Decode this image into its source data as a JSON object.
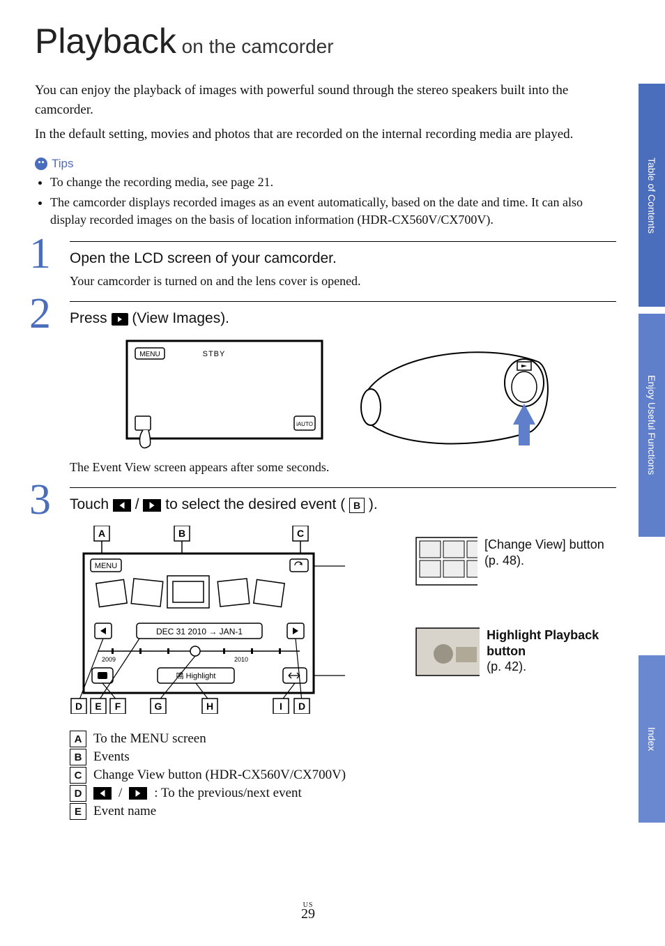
{
  "title_main": "Playback",
  "title_sub": " on the camcorder",
  "intro_p1": "You can enjoy the playback of images with powerful sound through the stereo speakers built into the camcorder.",
  "intro_p2": "In the default setting, movies and photos that are recorded on the internal recording media are played.",
  "tips_label": "Tips",
  "tips": {
    "item1": "To change the recording media, see page 21.",
    "item2": "The camcorder displays recorded images as an event automatically, based on the date and time. It can also display recorded images on the basis of location information (HDR-CX560V/CX700V)."
  },
  "steps": {
    "s1": {
      "num": "1",
      "head": "Open the LCD screen of your camcorder.",
      "body": "Your camcorder is turned on and the lens cover is opened."
    },
    "s2": {
      "num": "2",
      "head_pre": "Press ",
      "head_post": " (View Images).",
      "below": "The Event View screen appears after some seconds.",
      "lcd_menu": "MENU",
      "lcd_stby": "STBY"
    },
    "s3": {
      "num": "3",
      "head_pre": "Touch ",
      "head_mid": " / ",
      "head_post": " to select the desired event (",
      "head_end": ").",
      "letter_B": "B",
      "diagram": {
        "menu": "MENU",
        "date": "DEC 31 2010 → JAN-1",
        "year_left": "2009",
        "year_right": "2010",
        "highlight": "Highlight",
        "highlight_prefix": "鳴",
        "labels": {
          "A": "A",
          "B": "B",
          "C": "C",
          "D": "D",
          "E": "E",
          "F": "F",
          "G": "G",
          "H": "H",
          "I": "I"
        }
      },
      "callout1_a": "[Change View] button",
      "callout1_b": " (p. 48).",
      "callout2_a": "Highlight Playback button",
      "callout2_b": " (p. 42)."
    }
  },
  "legend": {
    "A": "To the MENU screen",
    "B": "Events",
    "C": "Change View button (HDR-CX560V/CX700V)",
    "D": " : To the previous/next event",
    "E": "Event name"
  },
  "sidetabs": {
    "toc": "Table of Contents",
    "enjoy": "Enjoy Useful Functions",
    "index": "Index"
  },
  "page_region": "US",
  "page_number": "29"
}
